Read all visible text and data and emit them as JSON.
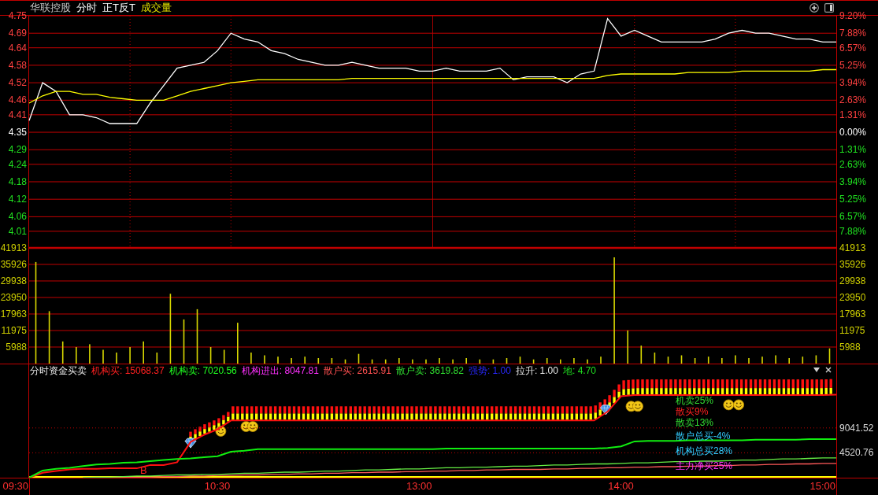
{
  "header": {
    "stock_name": "华联控股",
    "views": [
      "分时",
      "正T反T"
    ],
    "indicator": "成交量"
  },
  "price_panel": {
    "percent_labels": [
      {
        "label": "9.20%",
        "color": "#ff4040"
      },
      {
        "label": "7.88%",
        "color": "#ff4040"
      },
      {
        "label": "6.57%",
        "color": "#ff4040"
      },
      {
        "label": "5.25%",
        "color": "#ff4040"
      },
      {
        "label": "3.94%",
        "color": "#ff4040"
      },
      {
        "label": "2.63%",
        "color": "#ff4040"
      },
      {
        "label": "1.31%",
        "color": "#ff4040"
      },
      {
        "label": "0.00%",
        "color": "#ffffff"
      },
      {
        "label": "1.31%",
        "color": "#20e020"
      },
      {
        "label": "2.63%",
        "color": "#20e020"
      },
      {
        "label": "3.94%",
        "color": "#20e020"
      },
      {
        "label": "5.25%",
        "color": "#20e020"
      },
      {
        "label": "6.57%",
        "color": "#20e020"
      },
      {
        "label": "7.88%",
        "color": "#20e020"
      }
    ],
    "chart_data": {
      "type": "line",
      "grid": true,
      "ylim": [
        3.953,
        4.75
      ],
      "yticks": [
        {
          "value": 4.75,
          "label": "4.75"
        },
        {
          "value": 4.69,
          "label": "4.69"
        },
        {
          "value": 4.64,
          "label": "4.64"
        },
        {
          "value": 4.58,
          "label": "4.58"
        },
        {
          "value": 4.52,
          "label": "4.52"
        },
        {
          "value": 4.46,
          "label": "4.46"
        },
        {
          "value": 4.41,
          "label": "4.41"
        },
        {
          "value": 4.35,
          "label": "4.35"
        },
        {
          "value": 4.29,
          "label": "4.29"
        },
        {
          "value": 4.24,
          "label": "4.24"
        },
        {
          "value": 4.18,
          "label": "4.18"
        },
        {
          "value": 4.12,
          "label": "4.12"
        },
        {
          "value": 4.06,
          "label": "4.06"
        },
        {
          "value": 4.01,
          "label": "4.01"
        }
      ],
      "categories": [
        null,
        null,
        null,
        null,
        null,
        null,
        null,
        null,
        null,
        null,
        null,
        null,
        null,
        null,
        null,
        null,
        null,
        null,
        null,
        null,
        null,
        null,
        null,
        null,
        null,
        null,
        null,
        null,
        null,
        null,
        null,
        null,
        null,
        null,
        null,
        null,
        null,
        null,
        null,
        null,
        null,
        null,
        null,
        null,
        null,
        null,
        null,
        null,
        null,
        null,
        null,
        null,
        null,
        null,
        null,
        null,
        null,
        null,
        null,
        null,
        null
      ],
      "series": [
        {
          "color": "#ffffff",
          "values": [
            4.39,
            4.52,
            4.49,
            4.41,
            4.41,
            4.4,
            4.38,
            4.38,
            4.38,
            4.45,
            4.51,
            4.57,
            4.58,
            4.59,
            4.63,
            4.69,
            4.67,
            4.66,
            4.63,
            4.62,
            4.6,
            4.59,
            4.58,
            4.58,
            4.59,
            4.58,
            4.57,
            4.57,
            4.57,
            4.56,
            4.56,
            4.57,
            4.56,
            4.56,
            4.56,
            4.57,
            4.53,
            4.54,
            4.54,
            4.54,
            4.52,
            4.55,
            4.56,
            4.74,
            4.68,
            4.7,
            4.68,
            4.66,
            4.66,
            4.66,
            4.66,
            4.67,
            4.69,
            4.7,
            4.69,
            4.69,
            4.68,
            4.67,
            4.67,
            4.66,
            4.66
          ]
        },
        {
          "color": "#ffff00",
          "values": [
            4.45,
            4.475,
            4.49,
            4.49,
            4.48,
            4.48,
            4.47,
            4.465,
            4.46,
            4.46,
            4.46,
            4.475,
            4.49,
            4.5,
            4.51,
            4.52,
            4.525,
            4.53,
            4.53,
            4.53,
            4.53,
            4.53,
            4.53,
            4.53,
            4.535,
            4.535,
            4.535,
            4.535,
            4.535,
            4.535,
            4.535,
            4.535,
            4.535,
            4.535,
            4.535,
            4.535,
            4.535,
            4.535,
            4.535,
            4.535,
            4.535,
            4.535,
            4.535,
            4.545,
            4.55,
            4.55,
            4.55,
            4.55,
            4.55,
            4.555,
            4.555,
            4.555,
            4.555,
            4.56,
            4.56,
            4.56,
            4.56,
            4.56,
            4.56,
            4.565,
            4.565
          ]
        }
      ]
    }
  },
  "volume_panel": {
    "right_labels": [
      "41913",
      "35926",
      "29938",
      "23950",
      "17963",
      "11975",
      "5988"
    ],
    "chart_data": {
      "type": "bar",
      "grid": true,
      "ylim": [
        0,
        41913
      ],
      "yticks": [
        {
          "value": 41913,
          "label": "41913"
        },
        {
          "value": 35926,
          "label": "35926"
        },
        {
          "value": 29938,
          "label": "29938"
        },
        {
          "value": 23950,
          "label": "23950"
        },
        {
          "value": 17963,
          "label": "17963"
        },
        {
          "value": 11975,
          "label": "11975"
        },
        {
          "value": 5988,
          "label": "5988"
        }
      ],
      "categories": [
        null,
        null,
        null,
        null,
        null,
        null,
        null,
        null,
        null,
        null,
        null,
        null,
        null,
        null,
        null,
        null,
        null,
        null,
        null,
        null,
        null,
        null,
        null,
        null,
        null,
        null,
        null,
        null,
        null,
        null,
        null,
        null,
        null,
        null,
        null,
        null,
        null,
        null,
        null,
        null,
        null,
        null,
        null,
        null,
        null,
        null,
        null,
        null,
        null,
        null,
        null,
        null,
        null,
        null,
        null,
        null,
        null,
        null,
        null,
        null
      ],
      "series": [
        {
          "color": "#d8d800",
          "values": [
            36800,
            19000,
            8000,
            6000,
            7000,
            5000,
            4000,
            6000,
            8000,
            4000,
            25300,
            16000,
            19700,
            6000,
            5000,
            14800,
            4000,
            3000,
            2500,
            2000,
            2500,
            2000,
            2000,
            1500,
            3500,
            1500,
            1500,
            2000,
            1500,
            1500,
            2000,
            1500,
            2000,
            1500,
            1500,
            2000,
            2500,
            1500,
            2000,
            1500,
            2000,
            1500,
            2500,
            38500,
            12000,
            6500,
            4000,
            2500,
            3000,
            2000,
            2500,
            2000,
            3000,
            2000,
            2500,
            3000,
            2000,
            2500,
            3000,
            5500
          ]
        }
      ]
    }
  },
  "indicator_panel": {
    "title": "分时资金买卖",
    "metrics": [
      {
        "text": "机构买: 15068.37",
        "color": "#ff2020"
      },
      {
        "text": "机构卖: 7020.56",
        "color": "#20ff20"
      },
      {
        "text": "机构进出: 8047.81",
        "color": "#ff30ff"
      },
      {
        "text": "散户买: 2615.91",
        "color": "#ff5050"
      },
      {
        "text": "散户卖: 3619.82",
        "color": "#30e030"
      },
      {
        "text": "强势: 1.00",
        "color": "#2828ff"
      },
      {
        "text": "拉升: 1.00",
        "color": "#e8e8e8"
      },
      {
        "text": "地: 4.70",
        "color": "#20e020"
      }
    ],
    "legend_details": [
      {
        "text": "机卖25%",
        "color": "#33dd33"
      },
      {
        "text": "散买9%",
        "color": "#ff2020"
      },
      {
        "text": "散卖13%",
        "color": "#33dd33"
      }
    ],
    "legend_totals": [
      {
        "text": "散户总买-4%",
        "color": "#33ccff"
      },
      {
        "text": "机构总买28%",
        "color": "#33ccff"
      },
      {
        "text": "主力净买25%",
        "color": "#ff33ff"
      }
    ],
    "signal_label": "B",
    "chart_data": {
      "type": "line",
      "grid": true,
      "ylim": [
        0,
        20600
      ],
      "yticks": [
        {
          "value": 9041.52,
          "label": "9041.52"
        },
        {
          "value": 4520.76,
          "label": "4520.76"
        }
      ],
      "categories": [
        null,
        null,
        null,
        null,
        null,
        null,
        null,
        null,
        null,
        null,
        null,
        null,
        null,
        null,
        null,
        null,
        null,
        null,
        null,
        null,
        null,
        null,
        null,
        null,
        null,
        null,
        null,
        null,
        null,
        null,
        null,
        null,
        null,
        null,
        null,
        null,
        null,
        null,
        null,
        null,
        null,
        null,
        null,
        null,
        null,
        null,
        null,
        null,
        null,
        null,
        null,
        null,
        null,
        null,
        null,
        null,
        null,
        null,
        null,
        null,
        null
      ],
      "series": [
        {
          "color": "#ff1010",
          "values": [
            0,
            900,
            1200,
            1500,
            1600,
            1600,
            1700,
            1700,
            1700,
            2300,
            2300,
            2800,
            6500,
            7800,
            8800,
            10400,
            10400,
            10400,
            10400,
            10400,
            10400,
            10400,
            10400,
            10400,
            10400,
            10400,
            10400,
            10400,
            10400,
            10400,
            10400,
            10400,
            10400,
            10400,
            10400,
            10400,
            10400,
            10400,
            10400,
            10400,
            10400,
            10400,
            10400,
            12000,
            14800,
            15000,
            15000,
            15000,
            15000,
            15000,
            15000,
            15000,
            15000,
            15000,
            15000,
            15000,
            15000,
            15000,
            15000,
            15000,
            15100
          ]
        },
        {
          "color": "#10ee10",
          "values": [
            0,
            1300,
            1600,
            1800,
            2100,
            2400,
            2500,
            2700,
            2800,
            3000,
            3200,
            3400,
            3500,
            3700,
            3900,
            4700,
            4900,
            5200,
            5200,
            5200,
            5200,
            5200,
            5200,
            5200,
            5200,
            5200,
            5200,
            5200,
            5200,
            5200,
            5200,
            5300,
            5300,
            5300,
            5300,
            5300,
            5300,
            5300,
            5300,
            5300,
            5300,
            5300,
            5300,
            5400,
            5700,
            6600,
            6700,
            6700,
            6700,
            6800,
            6800,
            6800,
            6800,
            6800,
            6900,
            6900,
            6900,
            6900,
            7000,
            7000,
            7000
          ]
        },
        {
          "color": "#ff5a5a",
          "values": [
            null,
            null,
            null,
            null,
            null,
            null,
            0,
            0,
            100,
            100,
            200,
            200,
            300,
            300,
            400,
            400,
            500,
            500,
            600,
            600,
            700,
            700,
            800,
            800,
            900,
            900,
            1000,
            1000,
            1100,
            1100,
            1200,
            1200,
            1300,
            1300,
            1400,
            1400,
            1500,
            1500,
            1500,
            1600,
            1600,
            1700,
            1700,
            1800,
            1800,
            1900,
            1900,
            2000,
            2000,
            2100,
            2100,
            2200,
            2200,
            2300,
            2300,
            2400,
            2400,
            2500,
            2500,
            2600,
            2600
          ]
        },
        {
          "color": "#66ee44",
          "values": [
            null,
            null,
            null,
            null,
            0,
            100,
            100,
            200,
            300,
            300,
            400,
            500,
            500,
            600,
            600,
            700,
            800,
            800,
            900,
            1000,
            1000,
            1100,
            1200,
            1200,
            1300,
            1400,
            1400,
            1500,
            1600,
            1600,
            1700,
            1800,
            1800,
            1900,
            1900,
            2000,
            2100,
            2100,
            2200,
            2300,
            2300,
            2400,
            2500,
            2500,
            2600,
            2700,
            2700,
            2800,
            2900,
            2900,
            3000,
            3000,
            3100,
            3200,
            3200,
            3300,
            3400,
            3400,
            3500,
            3600,
            3600
          ]
        }
      ]
    }
  },
  "time_axis": [
    "09:30",
    "10:30",
    "13:00",
    "14:00",
    "15:00"
  ]
}
